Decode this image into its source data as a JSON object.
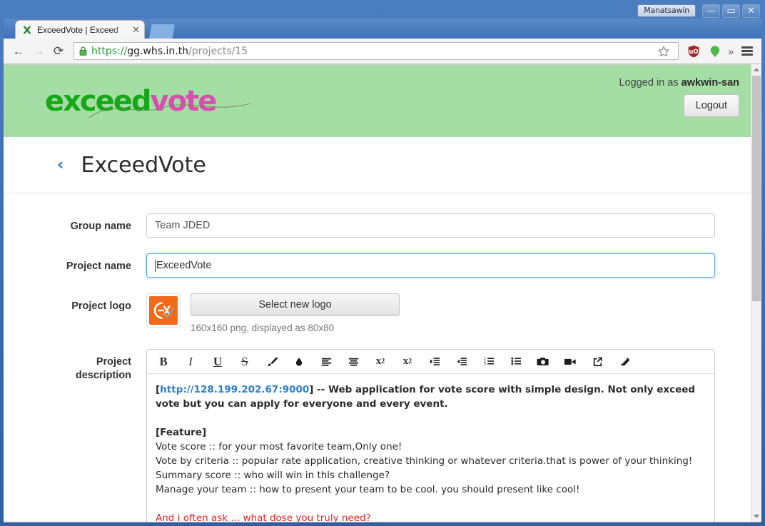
{
  "os_window": {
    "app_name": "Manatsawin",
    "minimize_label": "—",
    "maximize_label": "▭",
    "close_label": "✕"
  },
  "browser": {
    "tab": {
      "title": "ExceedVote | Exceed",
      "favicon": "green-x-favicon",
      "close_label": "✕"
    },
    "new_tab_label": "",
    "nav": {
      "back_label": "←",
      "forward_label": "→",
      "reload_label": "⟳"
    },
    "omnibox": {
      "lock_icon": "padlock-icon",
      "url_scheme": "https://",
      "url_host": "gg.whs.in.th",
      "url_path": "/projects/15",
      "full_url": "https://gg.whs.in.th/projects/15"
    },
    "icons": {
      "star": "bookmark-star-icon",
      "ublock": "ublock-origin-icon",
      "balloon": "green-balloon-icon",
      "overflow": "»",
      "menu": "hamburger-menu-icon"
    }
  },
  "app": {
    "brand": {
      "part1": "exceed",
      "part2": "vote",
      "color1": "#17a81a",
      "color2": "#d94fb0",
      "header_bg": "#a4dea4"
    },
    "login_prefix": "Logged in as ",
    "login_user": "awkwin-san",
    "logout_label": "Logout",
    "back_chevron": "‹",
    "page_heading": "ExceedVote"
  },
  "form": {
    "group_name": {
      "label": "Group name",
      "value": "Team JDED",
      "placeholder": "Group name"
    },
    "project_name": {
      "label": "Project name",
      "value": "ExceedVote",
      "placeholder": "Project name",
      "focused": true
    },
    "project_logo": {
      "label": "Project logo",
      "thumb_alt": "Ex logo with check mark",
      "thumb_bg": "#f26a17",
      "button_label": "Select new logo",
      "hint": "160x160 png, displayed as 80x80"
    },
    "project_description": {
      "label_line1": "Project",
      "label_line2": "description",
      "toolbar": [
        {
          "name": "bold-icon",
          "label": "B"
        },
        {
          "name": "italic-icon",
          "label": "I"
        },
        {
          "name": "underline-icon",
          "label": "U"
        },
        {
          "name": "strikethrough-icon",
          "label": "S"
        },
        {
          "name": "brush-icon",
          "label": ""
        },
        {
          "name": "droplet-icon",
          "label": ""
        },
        {
          "name": "align-left-icon",
          "label": ""
        },
        {
          "name": "align-center-icon",
          "label": ""
        },
        {
          "name": "subscript-icon",
          "label": "x"
        },
        {
          "name": "superscript-icon",
          "label": "x"
        },
        {
          "name": "indent-icon",
          "label": ""
        },
        {
          "name": "outdent-icon",
          "label": ""
        },
        {
          "name": "ordered-list-icon",
          "label": ""
        },
        {
          "name": "unordered-list-icon",
          "label": ""
        },
        {
          "name": "camera-icon",
          "label": ""
        },
        {
          "name": "video-icon",
          "label": ""
        },
        {
          "name": "link-icon",
          "label": ""
        },
        {
          "name": "eraser-icon",
          "label": ""
        }
      ],
      "content": {
        "link_text": "http://128.199.202.67:9000",
        "lead_open": "[",
        "lead_close": "] -- Web application for vote score with simple design. Not only exceed vote but you can apply for everyone and every event.",
        "feature_heading": "[Feature]",
        "features": [
          "Vote score :: for your most favorite team,Only one!",
          "Vote by criteria :: popular rate application, creative thinking or whatever criteria.that is power of your thinking!",
          "Summary score :: who will win in this challenge?",
          "Manage your team :: how to present your team to be cool. you should present like cool!"
        ],
        "closing_red": "And i often ask ... what dose you truly need?"
      }
    }
  },
  "scrollbar": {
    "up_label": "▲",
    "down_label": "▼"
  }
}
